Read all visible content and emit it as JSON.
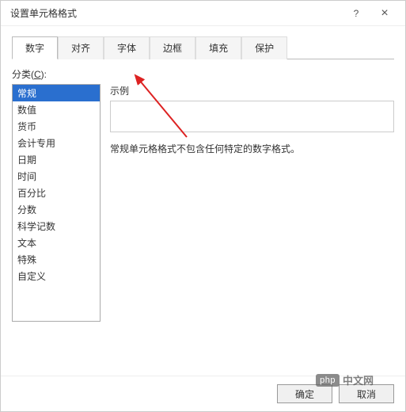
{
  "dialog": {
    "title": "设置单元格格式",
    "help_icon": "?",
    "close_icon": "×"
  },
  "tabs": [
    {
      "label": "数字",
      "active": true
    },
    {
      "label": "对齐",
      "active": false
    },
    {
      "label": "字体",
      "active": false
    },
    {
      "label": "边框",
      "active": false
    },
    {
      "label": "填充",
      "active": false
    },
    {
      "label": "保护",
      "active": false
    }
  ],
  "category": {
    "label_pre": "分类(",
    "label_key": "C",
    "label_post": "):",
    "items": [
      "常规",
      "数值",
      "货币",
      "会计专用",
      "日期",
      "时间",
      "百分比",
      "分数",
      "科学记数",
      "文本",
      "特殊",
      "自定义"
    ],
    "selected_index": 0
  },
  "sample": {
    "label": "示例"
  },
  "description": "常规单元格格式不包含任何特定的数字格式。",
  "buttons": {
    "ok": "确定",
    "cancel": "取消"
  },
  "watermark": {
    "logo": "php",
    "text": "中文网"
  }
}
